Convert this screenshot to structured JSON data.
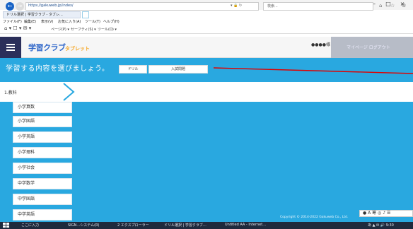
{
  "browser": {
    "window_controls": [
      "–",
      "□",
      "×"
    ],
    "back_glyph": "←",
    "forward_glyph": "→",
    "url": "https://gakuweb.jp/index/",
    "address_icons": "▾ 🔒 ↻",
    "search_placeholder": "検索...",
    "toolbar_glyphs": [
      "⌂",
      "☆",
      "⚙"
    ],
    "tab_title": "ドリル選択 | 学習クラブ - タブレ…",
    "menu": [
      "ファイル(F)",
      "編集(E)",
      "表示(V)",
      "お気に入り(A)",
      "ツール(T)",
      "ヘルプ(H)"
    ],
    "favorites": [
      "ページ(P) ▾",
      "セーフティ(S) ▾",
      "ツール(O) ▾"
    ]
  },
  "app": {
    "logo_main": "学習クラブ",
    "logo_sub": "タブレット",
    "header_right": "●●●●様",
    "header_dark_text": "マイページ ログアウト",
    "page_title": "学習する内容を選びましょう。",
    "tabs": [
      "ドリル",
      "入試問題"
    ],
    "step_label": "1.教科",
    "subjects": [
      "小学算数",
      "小学国語",
      "小学英語",
      "小学理科",
      "小学社会",
      "中学数学",
      "中学国語",
      "中学英語"
    ],
    "copyright": "Copyright © 2014-2022 Gakuweb Co., Ltd.",
    "tool_glyphs": "● A 寒 ◎ ♪ ☰"
  },
  "taskbar": {
    "items": [
      "ここに入力",
      "SIGN…システム(R)",
      "2 エクスプローラー",
      "ドリル選択 | 学習クラブ…",
      "Untitled AA - Internet…"
    ],
    "tray": "あ  ▲ ✉ 🔊  9:30"
  },
  "colors": {
    "accent": "#29a8e0",
    "brand": "#2e66c9",
    "annotation_red": "#e00000"
  }
}
